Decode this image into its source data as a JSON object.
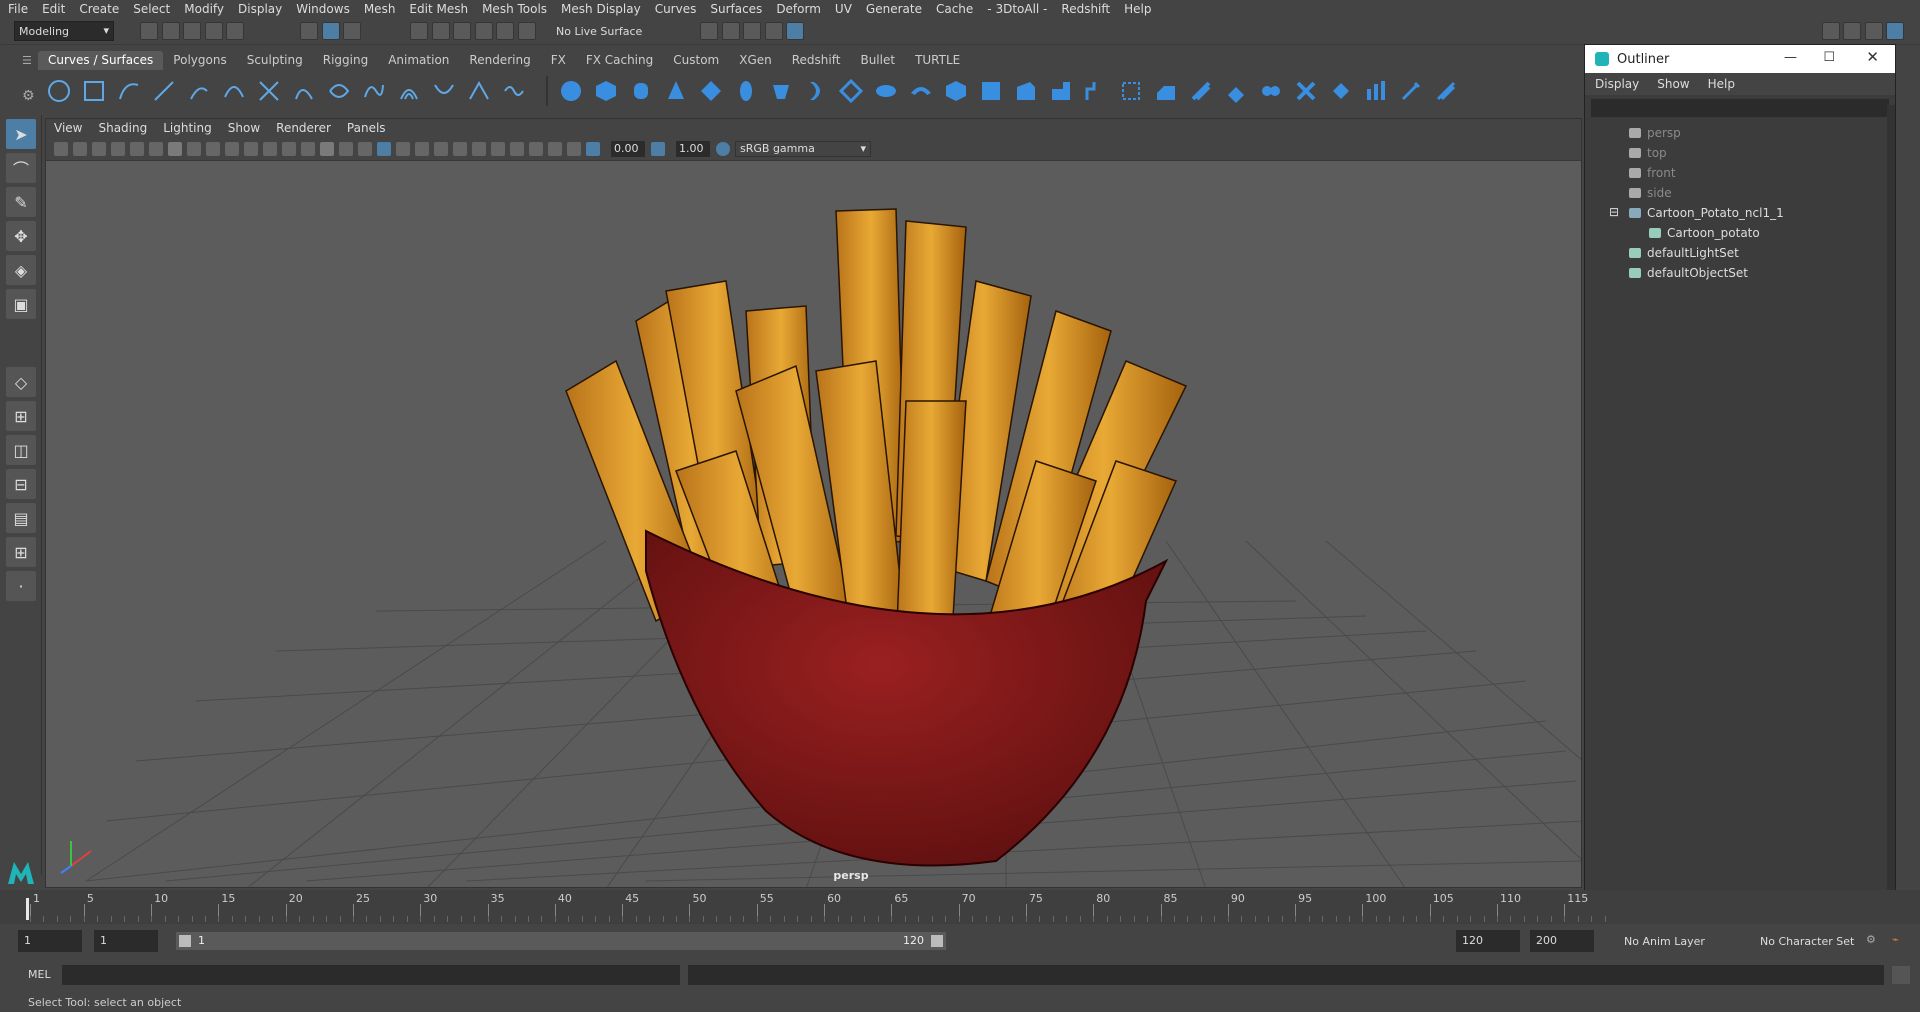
{
  "menubar": [
    "File",
    "Edit",
    "Create",
    "Select",
    "Modify",
    "Display",
    "Windows",
    "Mesh",
    "Edit Mesh",
    "Mesh Tools",
    "Mesh Display",
    "Curves",
    "Surfaces",
    "Deform",
    "UV",
    "Generate",
    "Cache",
    "- 3DtoAll -",
    "Redshift",
    "Help"
  ],
  "status": {
    "mode": "Modeling",
    "live_surface": "No Live Surface"
  },
  "shelf_tabs": [
    "Curves / Surfaces",
    "Polygons",
    "Sculpting",
    "Rigging",
    "Animation",
    "Rendering",
    "FX",
    "FX Caching",
    "Custom",
    "XGen",
    "Redshift",
    "Bullet",
    "TURTLE"
  ],
  "viewport": {
    "menu": [
      "View",
      "Shading",
      "Lighting",
      "Show",
      "Renderer",
      "Panels"
    ],
    "exposure": "0.00",
    "gamma": "1.00",
    "colorspace": "sRGB gamma",
    "camera_label": "persp"
  },
  "outliner": {
    "title": "Outliner",
    "menu": [
      "Display",
      "Show",
      "Help"
    ],
    "items": [
      {
        "label": "persp",
        "dim": true
      },
      {
        "label": "top",
        "dim": true
      },
      {
        "label": "front",
        "dim": true
      },
      {
        "label": "side",
        "dim": true
      },
      {
        "label": "Cartoon_Potato_ncl1_1",
        "dim": false
      },
      {
        "label": "Cartoon_potato",
        "dim": false
      },
      {
        "label": "defaultLightSet",
        "dim": false
      },
      {
        "label": "defaultObjectSet",
        "dim": false
      }
    ]
  },
  "timeline": {
    "ticks": [
      "1",
      "5",
      "10",
      "15",
      "20",
      "25",
      "30",
      "35",
      "40",
      "45",
      "50",
      "55",
      "60",
      "65",
      "70",
      "75",
      "80",
      "85",
      "90",
      "95",
      "100",
      "105",
      "110",
      "115"
    ]
  },
  "range": {
    "start": "1",
    "current": "1",
    "slider_start": "1",
    "slider_end": "120",
    "end": "120",
    "max": "200",
    "anim_layer": "No Anim Layer",
    "char_set": "No Character Set"
  },
  "mel": {
    "label": "MEL"
  },
  "help": "Select Tool: select an object",
  "colors": {
    "accent": "#4d7fa6",
    "fries": "#e0a12e",
    "box": "#8f1c1c"
  }
}
